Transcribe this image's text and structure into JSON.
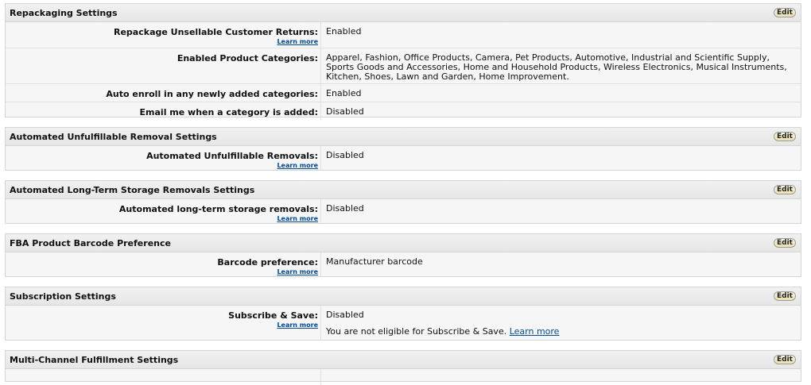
{
  "repackaging": {
    "title": "Repackaging Settings",
    "edit_label": "Edit",
    "rows": [
      {
        "label": "Repackage Unsellable Customer Returns:",
        "learn": "Learn more",
        "value": "Enabled"
      },
      {
        "label": "Enabled Product Categories:",
        "value": "Apparel, Fashion, Office Products, Camera, Pet Products, Automotive, Industrial and Scientific Supply, Sports Goods and Accessories, Home and Household Products, Wireless Electronics, Musical Instruments, Kitchen, Shoes, Lawn and Garden, Home Improvement."
      },
      {
        "label": "Auto enroll in any newly added categories:",
        "value": "Enabled"
      },
      {
        "label": "Email me when a category is added:",
        "value": "Disabled"
      }
    ]
  },
  "unfulfillable": {
    "title": "Automated Unfulfillable Removal Settings",
    "edit_label": "Edit",
    "rows": [
      {
        "label": "Automated Unfulfillable Removals:",
        "learn": "Learn more",
        "value": "Disabled"
      }
    ]
  },
  "longterm": {
    "title": "Automated Long-Term Storage Removals Settings",
    "edit_label": "Edit",
    "rows": [
      {
        "label": "Automated long-term storage removals:",
        "learn": "Learn more",
        "value": "Disabled"
      }
    ]
  },
  "barcode": {
    "title": "FBA Product Barcode Preference",
    "edit_label": "Edit",
    "rows": [
      {
        "label": "Barcode preference:",
        "learn": "Learn more",
        "value": "Manufacturer barcode"
      }
    ]
  },
  "subscription": {
    "title": "Subscription Settings",
    "edit_label": "Edit",
    "rows": [
      {
        "label": "Subscribe & Save:",
        "learn": "Learn more",
        "value": "Disabled",
        "note": "You are not eligible for Subscribe & Save.",
        "note_link": "Learn more"
      }
    ]
  },
  "mcf": {
    "title": "Multi-Channel Fulfillment Settings",
    "edit_label": "Edit"
  }
}
